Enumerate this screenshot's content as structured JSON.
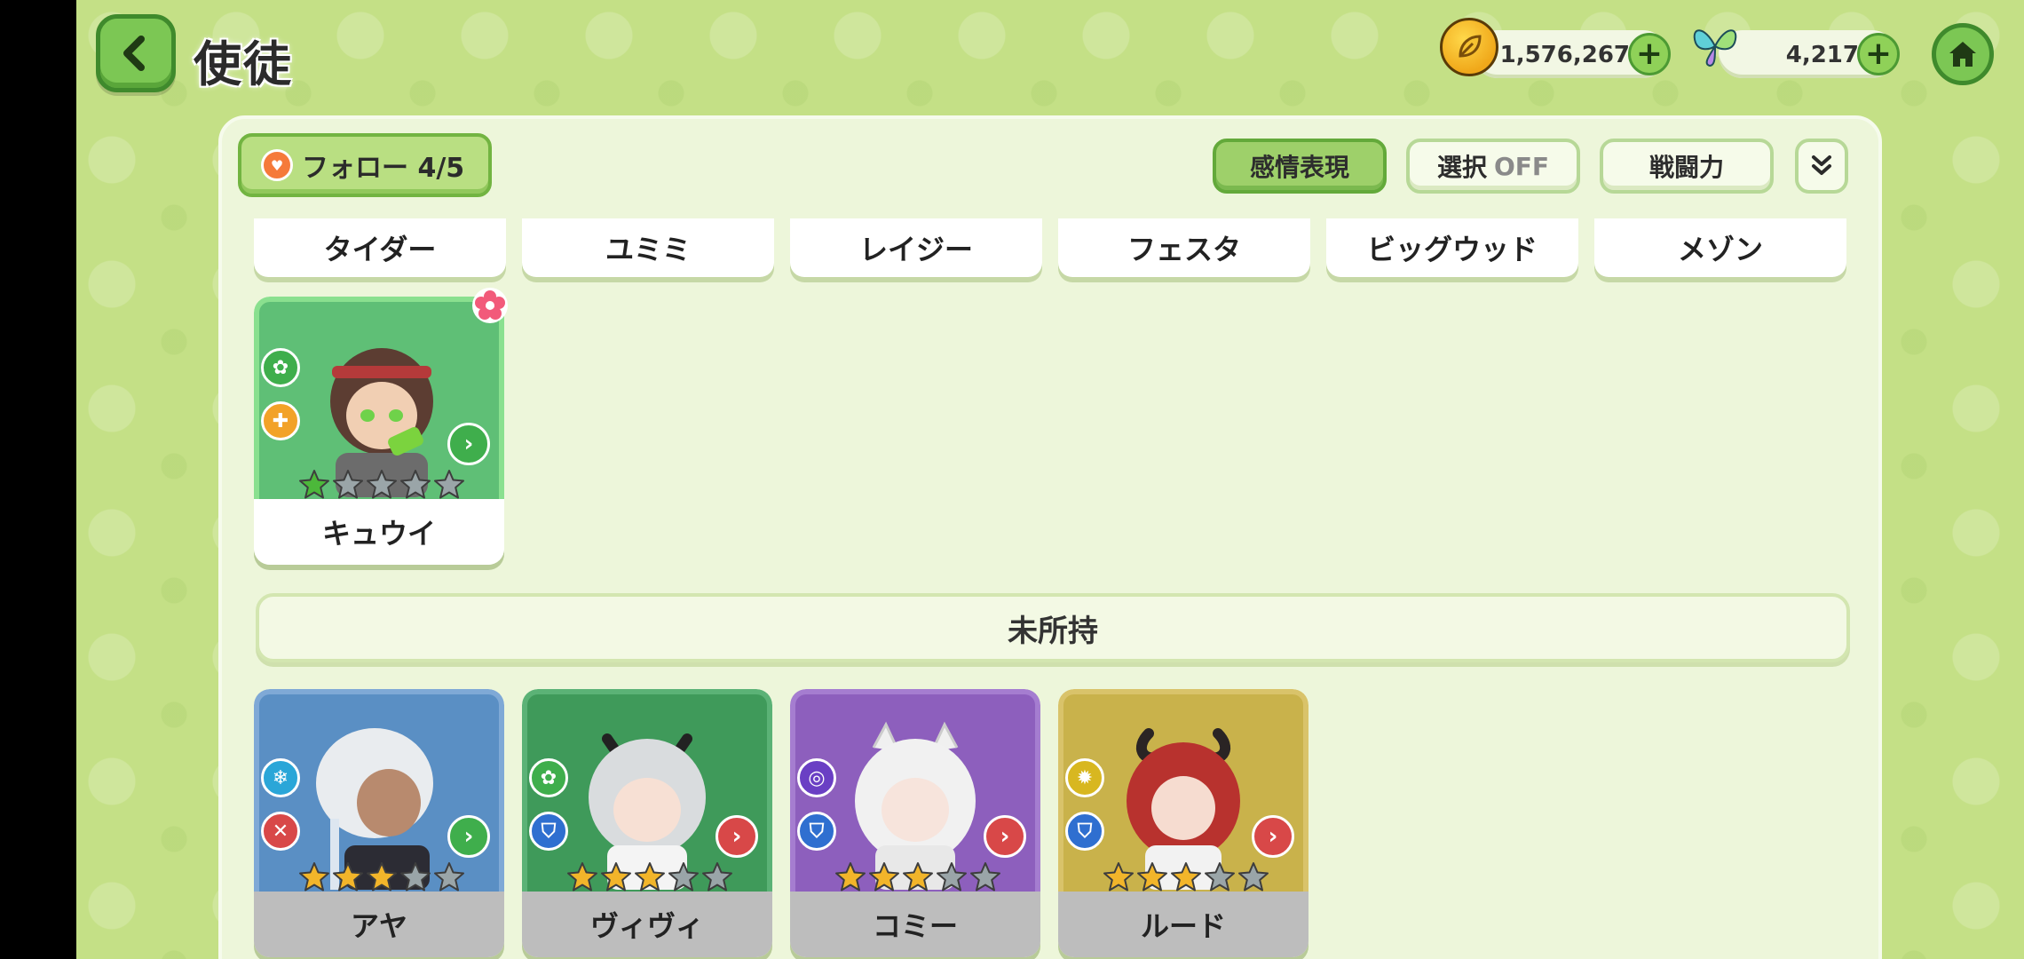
{
  "header": {
    "title": "使徒",
    "coins": "1,576,267",
    "gems": "4,217"
  },
  "toolbar": {
    "follow_label": "フォロー 4/5",
    "emotion_label": "感情表現",
    "select_label": "選択",
    "select_state": "OFF",
    "power_label": "戦闘力"
  },
  "name_tabs": [
    "タイダー",
    "ユミミ",
    "レイジー",
    "フェスタ",
    "ビッグウッド",
    "メゾン"
  ],
  "owned_cards": [
    {
      "name": "キュウイ",
      "stars": 1,
      "max_stars": 5,
      "bg": "#5fbf76"
    }
  ],
  "section_unowned": "未所持",
  "unowned_cards": [
    {
      "name": "アヤ",
      "stars": 3,
      "max_stars": 5,
      "bg": "#5a8fc4"
    },
    {
      "name": "ヴィヴィ",
      "stars": 3,
      "max_stars": 5,
      "bg": "#3f9a5a"
    },
    {
      "name": "コミー",
      "stars": 3,
      "max_stars": 5,
      "bg": "#8d5fbd"
    },
    {
      "name": "ルード",
      "stars": 3,
      "max_stars": 5,
      "bg": "#c9b24b"
    }
  ],
  "colors": {
    "accent_green": "#7cc754",
    "star_filled_green": "#4cb83a",
    "star_filled_gold": "#f2b52a",
    "star_empty": "#9aa5a8"
  },
  "icons": {
    "back": "chevron-left-icon",
    "home": "home-icon",
    "coin": "leaf-coin-icon",
    "gem": "butterfly-gem-icon",
    "expand": "double-chevron-down-icon"
  }
}
